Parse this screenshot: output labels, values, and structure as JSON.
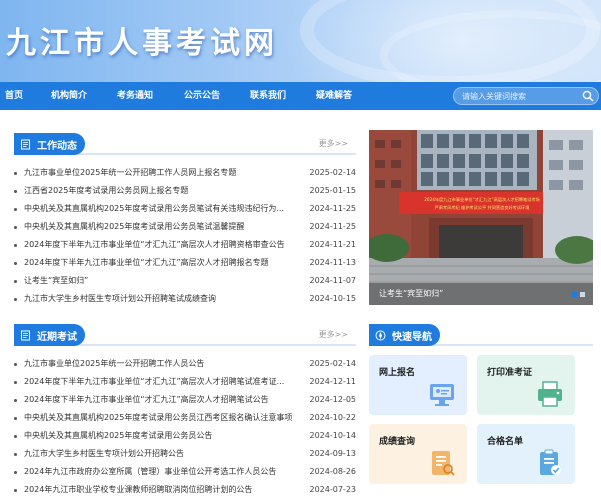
{
  "site": {
    "title": "九江市人事考试网"
  },
  "nav": {
    "items": [
      "首页",
      "机构简介",
      "考务通知",
      "公示公告",
      "联系我们",
      "疑难解答"
    ],
    "search_placeholder": "请输入关键词搜索"
  },
  "work": {
    "title": "工作动态",
    "more": "更多>>",
    "items": [
      {
        "title": "九江市事业单位2025年统一公开招聘工作人员网上报名专题",
        "date": "2025-02-14"
      },
      {
        "title": "江西省2025年度考试录用公务员网上报名专题",
        "date": "2025-01-15"
      },
      {
        "title": "中央机关及其直属机构2025年度考试录用公务员笔试有关违规违纪行为...",
        "date": "2024-11-25"
      },
      {
        "title": "中央机关及其直属机构2025年度考试录用公务员笔试温馨提醒",
        "date": "2024-11-25"
      },
      {
        "title": "2024年度下半年九江市事业单位“才汇九江”高层次人才招聘资格审查公告",
        "date": "2024-11-21"
      },
      {
        "title": "2024年度下半年九江市事业单位“才汇九江”高层次人才招聘报名专题",
        "date": "2024-11-13"
      },
      {
        "title": "让考生“宾至如归”",
        "date": "2024-11-07"
      },
      {
        "title": "九江市大学生乡村医生专项计划公开招聘笔试成绩查询",
        "date": "2024-10-15"
      }
    ]
  },
  "recent": {
    "title": "近期考试",
    "more": "更多>>",
    "items": [
      {
        "title": "九江市事业单位2025年统一公开招聘工作人员公告",
        "date": "2025-02-14"
      },
      {
        "title": "2024年度下半年九江市事业单位“才汇九江”高层次人才招聘笔试准考证...",
        "date": "2024-12-11"
      },
      {
        "title": "2024年度下半年九江市事业单位“才汇九江”高层次人才招聘笔试公告",
        "date": "2024-12-05"
      },
      {
        "title": "中央机关及其直属机构2025年度考试录用公务员江西考区报名确认注意事项",
        "date": "2024-10-22"
      },
      {
        "title": "中央机关及其直属机构2025年度考试录用公务员公告",
        "date": "2024-10-14"
      },
      {
        "title": "九江市大学生乡村医生专项计划公开招聘公告",
        "date": "2024-09-13"
      },
      {
        "title": "2024年九江市政府办公室所属（管理）事业单位公开考选工作人员公告",
        "date": "2024-08-26"
      },
      {
        "title": "2024年九江市职业学校专业课教师招聘取消岗位招聘计划的公告",
        "date": "2024-07-23"
      }
    ]
  },
  "slider": {
    "caption": "让考生“宾至如归”",
    "banner_text": "2024年度九江市事业单位“才汇九江”高层次人才招聘笔试考场 严肃考风考纪 维护考试公平 共同营造良好考试环境",
    "active_index": 0,
    "count": 2
  },
  "quick": {
    "title": "快速导航",
    "cards": [
      {
        "label": "网上报名",
        "icon": "monitor-icon",
        "bg": "#e3efff"
      },
      {
        "label": "打印准考证",
        "icon": "printer-icon",
        "bg": "#e3f4ef"
      },
      {
        "label": "成绩查询",
        "icon": "document-search-icon",
        "bg": "#fdf1e2"
      },
      {
        "label": "合格名单",
        "icon": "checklist-icon",
        "bg": "#e3f1fc"
      }
    ]
  },
  "colors": {
    "primary": "#1f7bde",
    "banner": "#a9cdf6"
  }
}
